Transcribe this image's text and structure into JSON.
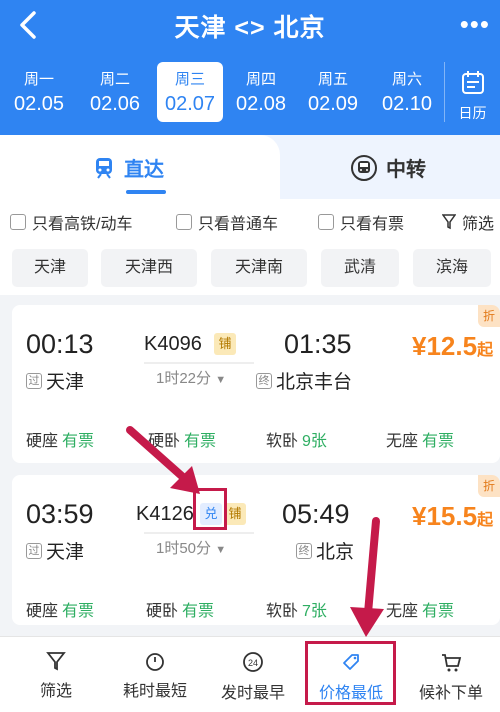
{
  "header": {
    "title": "天津 <> 北京",
    "more": "•••"
  },
  "dates": [
    {
      "week": "周一",
      "date": "02.05"
    },
    {
      "week": "周二",
      "date": "02.06"
    },
    {
      "week": "周三",
      "date": "02.07"
    },
    {
      "week": "周四",
      "date": "02.08"
    },
    {
      "week": "周五",
      "date": "02.09"
    },
    {
      "week": "周六",
      "date": "02.10"
    }
  ],
  "calendar_label": "日历",
  "tabs": {
    "direct": "直达",
    "transfer": "中转"
  },
  "filters": [
    "只看高铁/动车",
    "只看普通车",
    "只看有票",
    "筛选"
  ],
  "stations": [
    "天津",
    "天津西",
    "天津南",
    "武清",
    "滨海"
  ],
  "trains": [
    {
      "dep_time": "00:13",
      "arr_time": "01:35",
      "number": "K4096",
      "tag": "铺",
      "duration": "1时22分",
      "from_mark": "过",
      "from": "天津",
      "to_mark": "终",
      "to": "北京丰台",
      "price": "¥12.5",
      "price_suffix": "起",
      "corner": "折",
      "seats": [
        {
          "name": "硬座",
          "avail": "有票"
        },
        {
          "name": "硬卧",
          "avail": "有票"
        },
        {
          "name": "软卧",
          "avail": "9张"
        },
        {
          "name": "无座",
          "avail": "有票"
        }
      ]
    },
    {
      "dep_time": "03:59",
      "arr_time": "05:49",
      "number": "K4126",
      "tag_dui": "兑",
      "tag": "铺",
      "duration": "1时50分",
      "from_mark": "过",
      "from": "天津",
      "to_mark": "终",
      "to": "北京",
      "price": "¥15.5",
      "price_suffix": "起",
      "corner": "折",
      "seats": [
        {
          "name": "硬座",
          "avail": "有票"
        },
        {
          "name": "硬卧",
          "avail": "有票"
        },
        {
          "name": "软卧",
          "avail": "7张"
        },
        {
          "name": "无座",
          "avail": "有票"
        }
      ]
    }
  ],
  "bottom": [
    "筛选",
    "耗时最短",
    "发时最早",
    "价格最低",
    "候补下单"
  ],
  "clock_badge": "24",
  "colors": {
    "primary": "#2f84f2",
    "price": "#f7841d",
    "available": "#2eae62",
    "highlight": "#c51a4a"
  }
}
